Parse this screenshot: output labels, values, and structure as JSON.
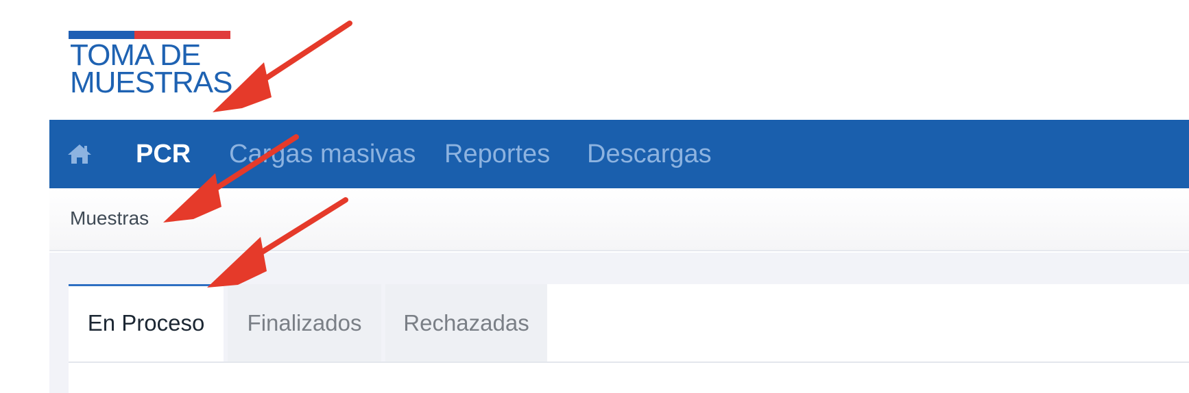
{
  "logo": {
    "line1": "TOMA DE",
    "line2": "MUESTRAS"
  },
  "nav": {
    "home_icon": "home-icon",
    "items": [
      {
        "label": "PCR",
        "active": true
      },
      {
        "label": "Cargas masivas",
        "active": false
      },
      {
        "label": "Reportes",
        "active": false
      },
      {
        "label": "Descargas",
        "active": false
      }
    ]
  },
  "breadcrumb": {
    "current": "Muestras"
  },
  "tabs": [
    {
      "label": "En Proceso",
      "active": true
    },
    {
      "label": "Finalizados",
      "active": false
    },
    {
      "label": "Rechazadas",
      "active": false
    }
  ],
  "colors": {
    "navbar": "#1a5fad",
    "nav_inactive_text": "#8db3e0",
    "logo_text": "#1e62b2",
    "logo_blue": "#1f5fb4",
    "logo_red": "#e03b3b",
    "active_tab_border": "#2e6fc2",
    "annotation_arrow": "#e53a2a"
  },
  "annotations": {
    "arrow_icon": "annotation-arrow",
    "count": 3
  }
}
